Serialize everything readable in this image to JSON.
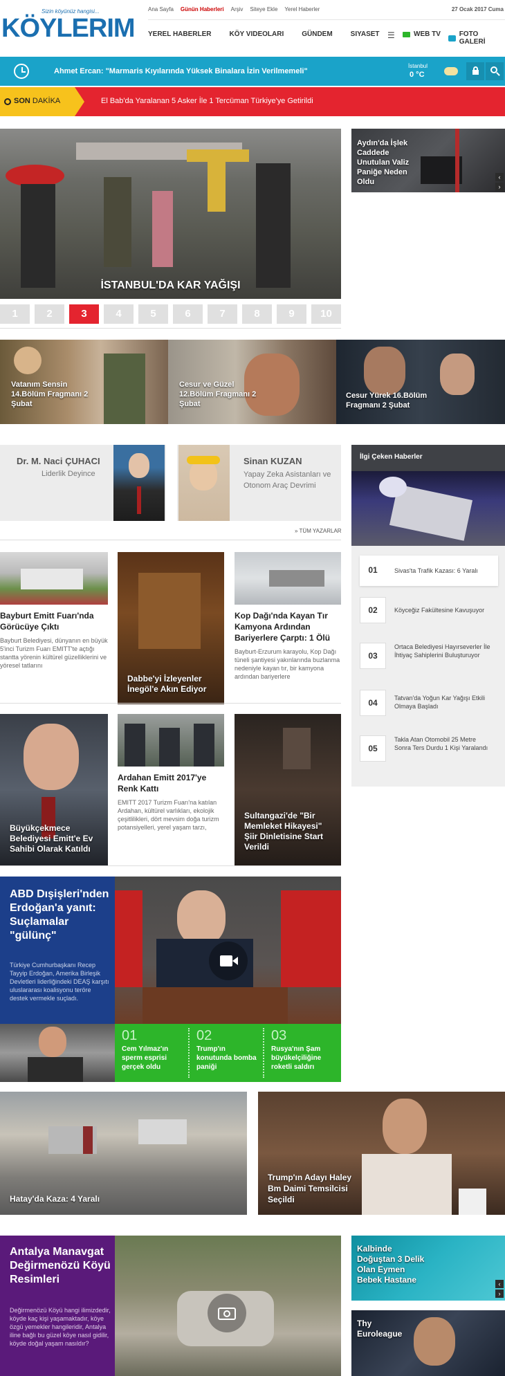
{
  "top_links": [
    "Ana Sayfa",
    "Günün Haberleri",
    "Arşiv",
    "Siteye Ekle",
    "Yerel Haberler"
  ],
  "date": "27 Ocak 2017 Cuma",
  "logo": {
    "text": "KÖYLERIM",
    "slogan": "Sizin köyünüz hangisi..."
  },
  "nav": [
    "YEREL HABERLER",
    "KÖY VIDEOLARI",
    "GÜNDEM",
    "SIYASET"
  ],
  "nav_right": {
    "tv": "WEB TV",
    "gallery": "FOTO GALERİ"
  },
  "ticker": {
    "text": "Ahmet Ercan: \"Marmaris Kıyılarında Yüksek Binalara İzin Verilmemeli\""
  },
  "weather": {
    "city": "İstanbul",
    "temp": "0 °C"
  },
  "breaking": {
    "label_bold": "SON",
    "label": "DAKİKA",
    "text": "El Bab'da Yaralanan 5 Asker İle 1 Tercüman Türkiye'ye Getirildi"
  },
  "slider": {
    "caption": "İSTANBUL'DA KAR YAĞIŞI",
    "pages": [
      "1",
      "2",
      "3",
      "4",
      "5",
      "6",
      "7",
      "8",
      "9",
      "10"
    ],
    "active": 3
  },
  "side_top": {
    "caption": "Aydın'da İşlek Caddede Unutulan Valiz Paniğe Neden Oldu"
  },
  "video_strip": [
    {
      "caption": "Vatanım Sensin 14.Bölüm Fragmanı 2 Şubat"
    },
    {
      "caption": "Cesur ve Güzel 12.Bölüm Fragmanı 2 Şubat"
    },
    {
      "caption": "Cesur Yürek 16.Bölüm Fragmanı 2 Şubat"
    }
  ],
  "authors": [
    {
      "name": "Dr. M. Naci ÇUHACI",
      "title": "Liderlik Deyince"
    },
    {
      "name": "Sinan KUZAN",
      "title": "Yapay Zeka Asistanları ve Otonom Araç Devrimi"
    }
  ],
  "all_authors": "» TÜM YAZARLAR",
  "cards_row1": [
    {
      "title": "Bayburt Emitt Fuarı'nda Görücüye Çıktı",
      "text": "Bayburt Belediyesi, dünyanın en büyük 5'inci Turizm Fuarı EMITT'te açtığı stantta yörenin kültürel güzelliklerini ve yöresel tatlarını"
    },
    {
      "title": "Dabbe'yi İzleyenler İnegöl'e Akın Ediyor"
    },
    {
      "title": "Kop Dağı'nda Kayan Tır Kamyona Ardından Bariyerlere Çarptı: 1 Ölü",
      "text": "Bayburt-Erzurum karayolu, Kop Dağı tüneli şantiyesi yakınlarında buzlanma nedeniyle kayan tır, bir kamyona ardından bariyerlere"
    }
  ],
  "cards_row2": [
    {
      "title": "Büyükçekmece Belediyesi Emitt'e Ev Sahibi Olarak Katıldı"
    },
    {
      "title": "Ardahan Emitt 2017'ye Renk Kattı",
      "text": "EMITT 2017 Turizm Fuarı'na katılan Ardahan, kültürel varlıkları, ekolojik çeşitlilikleri, dört mevsim doğa turizm potansiyelleri, yerel yaşam tarzı,"
    },
    {
      "title": "Sultangazi'de \"Bir Memleket Hikayesi\" Şiir Dinletisine Start Verildi"
    }
  ],
  "popular": {
    "title": "İlgi Çeken Haberler",
    "items": [
      {
        "num": "01",
        "text": "Sivas'ta Trafik Kazası: 6 Yaralı"
      },
      {
        "num": "02",
        "text": "Köyceğiz Fakültesine Kavuşuyor"
      },
      {
        "num": "03",
        "text": "Ortaca Belediyesi Hayırseverler İle İhtiyaç Sahiplerini Buluşturuyor"
      },
      {
        "num": "04",
        "text": "Tatvan'da Yoğun Kar Yağışı Etkili Olmaya Başladı"
      },
      {
        "num": "05",
        "text": "Takla Atan Otomobil 25 Metre Sonra Ters Durdu 1 Kişi Yaralandı"
      }
    ]
  },
  "feature": {
    "title": "ABD Dışişleri'nden Erdoğan'a yanıt: Suçlamalar \"gülünç\"",
    "text": "Türkiye Cumhurbaşkanı Recep Tayyip Erdoğan, Amerika Birleşik Devletleri liderliğindeki DEAŞ karşıtı uluslararası koalisyonu teröre destek vermekle suçladı.",
    "items": [
      {
        "num": "01",
        "text": "Cem Yılmaz'ın sperm esprisi gerçek oldu"
      },
      {
        "num": "02",
        "text": "Trump'ın konutunda bomba paniği"
      },
      {
        "num": "03",
        "text": "Rusya'nın Şam büyükelçiliğine roketli saldırı"
      }
    ]
  },
  "big_pair": [
    {
      "caption": "Hatay'da Kaza: 4 Yaralı"
    },
    {
      "caption": "Trump'ın Adayı Haley Bm Daimi Temsilcisi Seçildi"
    }
  ],
  "gallery": {
    "title": "Antalya Manavgat Değirmenözü Köyü Resimleri",
    "text": "Değirmenözü Köyü hangi ilimizdedir, köyde kaç kişi yaşamaktadır, köye özgü yemekler hangileridir, Antalya iline bağlı bu güzel köye nasıl gidilir, köyde doğal yaşam nasıldır?"
  },
  "side_bottom": [
    {
      "caption": "Kalbinde Doğuştan 3 Delik Olan Eymen Bebek Hastane"
    },
    {
      "caption": "Thy Euroleague"
    }
  ],
  "colors": {
    "accent": "#1aa3c9",
    "breaking": "#e4242f",
    "gallery": "#5a1a7a",
    "feature": "#1c3f8a",
    "green": "#2db52a"
  }
}
